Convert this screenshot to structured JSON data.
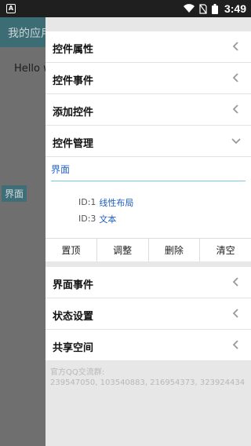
{
  "status_bar": {
    "time": "3:49",
    "app_icon": "A"
  },
  "background": {
    "title": "我的应用",
    "hello": "Hello w",
    "label": "界面"
  },
  "drawer": {
    "top_menu": [
      {
        "label": "控件属性",
        "state": "collapsed"
      },
      {
        "label": "控件事件",
        "state": "collapsed"
      },
      {
        "label": "添加控件",
        "state": "collapsed"
      },
      {
        "label": "控件管理",
        "state": "expanded"
      }
    ],
    "panel": {
      "title": "界面",
      "items": [
        {
          "id": "ID:1",
          "name": "线性布局"
        },
        {
          "id": "ID:3",
          "name": "文本"
        }
      ],
      "actions": [
        "置顶",
        "调整",
        "删除",
        "清空"
      ]
    },
    "bottom_menu": [
      {
        "label": "界面事件",
        "state": "collapsed"
      },
      {
        "label": "状态设置",
        "state": "collapsed"
      },
      {
        "label": "共享空间",
        "state": "collapsed"
      }
    ],
    "qq_info": {
      "line1": "官方QQ交流群:",
      "line2": "239547050, 103540883, 216954373, 323924434"
    }
  },
  "colors": {
    "accent": "#2a64c8",
    "divider": "#7ec7dd",
    "toolbar": "#3d6d74"
  }
}
